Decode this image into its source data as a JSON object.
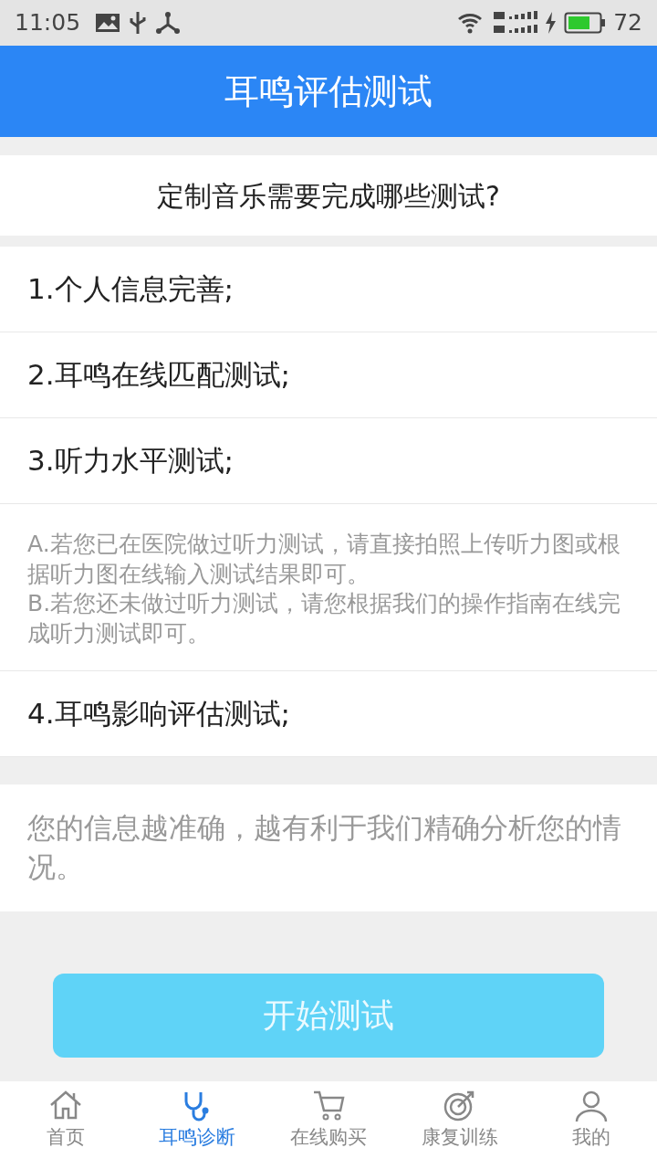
{
  "status_bar": {
    "time": "11:05",
    "battery": "72"
  },
  "header": {
    "title": "耳鸣评估测试"
  },
  "question": "定制音乐需要完成哪些测试?",
  "steps": [
    {
      "kind": "step",
      "text": "1.个人信息完善;"
    },
    {
      "kind": "step",
      "text": "2.耳鸣在线匹配测试;"
    },
    {
      "kind": "step",
      "text": "3.听力水平测试;"
    },
    {
      "kind": "note",
      "lines": [
        "A.若您已在医院做过听力测试，请直接拍照上传听力图或根据听力图在线输入测试结果即可。",
        "B.若您还未做过听力测试，请您根据我们的操作指南在线完成听力测试即可。"
      ]
    },
    {
      "kind": "step",
      "text": "4.耳鸣影响评估测试;"
    }
  ],
  "info": "您的信息越准确，越有利于我们精确分析您的情况。",
  "start_button": {
    "label": "开始测试"
  },
  "tabs": [
    {
      "label": "首页",
      "selected": false
    },
    {
      "label": "耳鸣诊断",
      "selected": true
    },
    {
      "label": "在线购买",
      "selected": false
    },
    {
      "label": "康复训练",
      "selected": false
    },
    {
      "label": "我的",
      "selected": false
    }
  ]
}
